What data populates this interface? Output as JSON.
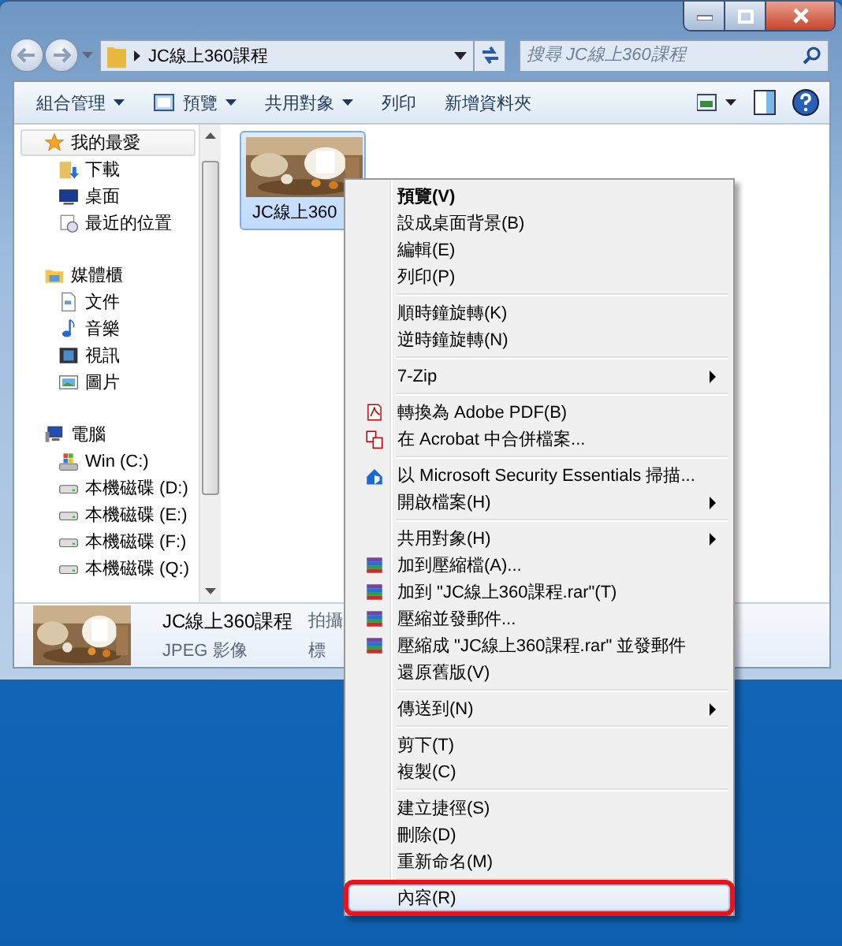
{
  "address_bar": {
    "path": "JC線上360課程"
  },
  "search": {
    "placeholder": "搜尋 JC線上360課程"
  },
  "toolbar": [
    {
      "label": "組合管理",
      "kind": "plain",
      "dropdown": true
    },
    {
      "label": "預覽",
      "kind": "preview",
      "dropdown": true
    },
    {
      "label": "共用對象",
      "kind": "plain",
      "dropdown": true
    },
    {
      "label": "列印",
      "kind": "plain",
      "dropdown": false
    },
    {
      "label": "新增資料夾",
      "kind": "plain",
      "dropdown": false
    }
  ],
  "navigation": [
    {
      "label": "我的最愛",
      "kind": "favorites",
      "selected": true,
      "children": [
        {
          "label": "下載",
          "kind": "downloads"
        },
        {
          "label": "桌面",
          "kind": "desktop"
        },
        {
          "label": "最近的位置",
          "kind": "recent"
        }
      ]
    },
    {
      "label": "媒體櫃",
      "kind": "libraries",
      "selected": false,
      "children": [
        {
          "label": "文件",
          "kind": "documents"
        },
        {
          "label": "音樂",
          "kind": "music"
        },
        {
          "label": "視訊",
          "kind": "video"
        },
        {
          "label": "圖片",
          "kind": "pictures"
        }
      ]
    },
    {
      "label": "電腦",
      "kind": "computer",
      "selected": false,
      "children": [
        {
          "label": "Win (C:)",
          "kind": "system_drive"
        },
        {
          "label": "本機磁碟 (D:)",
          "kind": "drive"
        },
        {
          "label": "本機磁碟 (E:)",
          "kind": "drive"
        },
        {
          "label": "本機磁碟 (F:)",
          "kind": "drive"
        },
        {
          "label": "本機磁碟 (Q:)",
          "kind": "drive"
        }
      ]
    }
  ],
  "files": [
    {
      "name": "JC線上360",
      "selected": true,
      "kind": "picture"
    }
  ],
  "details": {
    "lines": [
      [
        "JC線上360課程",
        "拍攝"
      ],
      [
        "JPEG 影像",
        "標"
      ]
    ]
  },
  "context_menu": {
    "groups": [
      {
        "items": [
          {
            "label": "預覽(V)",
            "kind": "plain",
            "default": true,
            "submenu": false,
            "selected": false
          },
          {
            "label": "設成桌面背景(B)",
            "kind": "plain",
            "default": false,
            "submenu": false,
            "selected": false
          },
          {
            "label": "編輯(E)",
            "kind": "plain",
            "default": false,
            "submenu": false,
            "selected": false
          },
          {
            "label": "列印(P)",
            "kind": "plain",
            "default": false,
            "submenu": false,
            "selected": false
          }
        ]
      },
      {
        "items": [
          {
            "label": "順時鐘旋轉(K)",
            "kind": "plain",
            "default": false,
            "submenu": false,
            "selected": false
          },
          {
            "label": "逆時鐘旋轉(N)",
            "kind": "plain",
            "default": false,
            "submenu": false,
            "selected": false
          }
        ]
      },
      {
        "items": [
          {
            "label": "7-Zip",
            "kind": "plain",
            "default": false,
            "submenu": true,
            "selected": false
          }
        ]
      },
      {
        "items": [
          {
            "label": "轉換為 Adobe PDF(B)",
            "kind": "pdf",
            "default": false,
            "submenu": false,
            "selected": false
          },
          {
            "label": "在 Acrobat 中合併檔案...",
            "kind": "pdf_merge",
            "default": false,
            "submenu": false,
            "selected": false
          }
        ]
      },
      {
        "items": [
          {
            "label": "以 Microsoft Security Essentials 掃描...",
            "kind": "shield",
            "default": false,
            "submenu": false,
            "selected": false
          },
          {
            "label": "開啟檔案(H)",
            "kind": "plain",
            "default": false,
            "submenu": true,
            "selected": false
          }
        ]
      },
      {
        "items": [
          {
            "label": "共用對象(H)",
            "kind": "plain",
            "default": false,
            "submenu": true,
            "selected": false
          },
          {
            "label": "加到壓縮檔(A)...",
            "kind": "archive",
            "default": false,
            "submenu": false,
            "selected": false
          },
          {
            "label": "加到 \"JC線上360課程.rar\"(T)",
            "kind": "archive",
            "default": false,
            "submenu": false,
            "selected": false
          },
          {
            "label": "壓縮並發郵件...",
            "kind": "archive",
            "default": false,
            "submenu": false,
            "selected": false
          },
          {
            "label": "壓縮成 \"JC線上360課程.rar\" 並發郵件",
            "kind": "archive",
            "default": false,
            "submenu": false,
            "selected": false
          },
          {
            "label": "還原舊版(V)",
            "kind": "plain",
            "default": false,
            "submenu": false,
            "selected": false
          }
        ]
      },
      {
        "items": [
          {
            "label": "傳送到(N)",
            "kind": "plain",
            "default": false,
            "submenu": true,
            "selected": false
          }
        ]
      },
      {
        "items": [
          {
            "label": "剪下(T)",
            "kind": "plain",
            "default": false,
            "submenu": false,
            "selected": false
          },
          {
            "label": "複製(C)",
            "kind": "plain",
            "default": false,
            "submenu": false,
            "selected": false
          }
        ]
      },
      {
        "items": [
          {
            "label": "建立捷徑(S)",
            "kind": "plain",
            "default": false,
            "submenu": false,
            "selected": false
          },
          {
            "label": "刪除(D)",
            "kind": "plain",
            "default": false,
            "submenu": false,
            "selected": false
          },
          {
            "label": "重新命名(M)",
            "kind": "plain",
            "default": false,
            "submenu": false,
            "selected": false
          }
        ]
      },
      {
        "items": [
          {
            "label": "內容(R)",
            "kind": "plain",
            "default": false,
            "submenu": false,
            "selected": true
          }
        ]
      }
    ]
  }
}
